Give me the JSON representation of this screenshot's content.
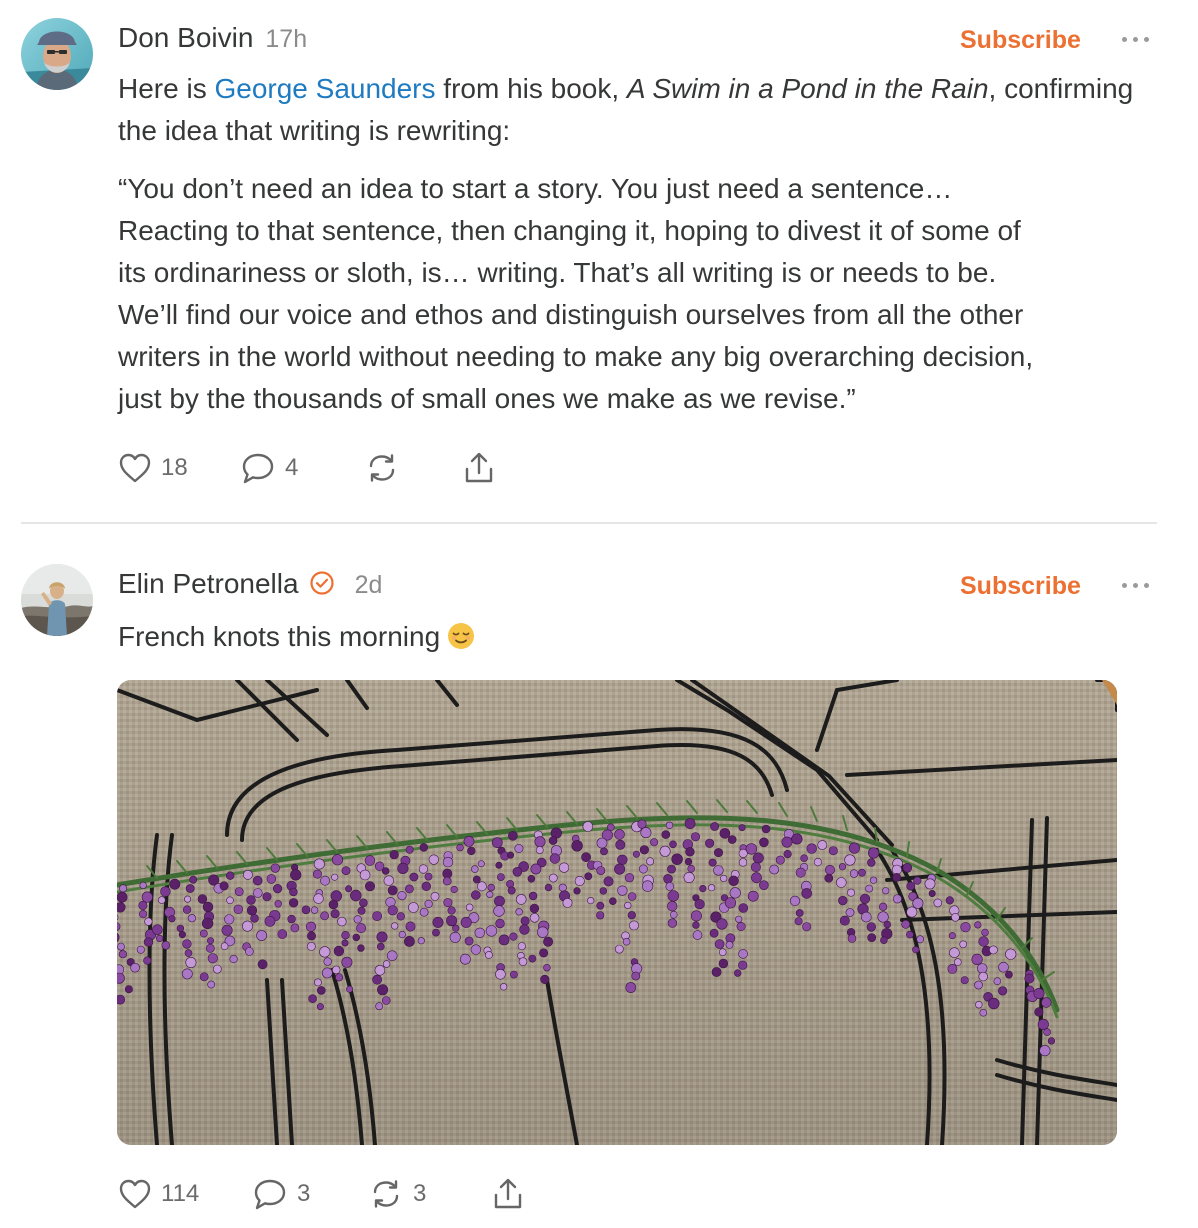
{
  "posts": [
    {
      "author": "Don Boivin",
      "time": "17h",
      "subscribe_label": "Subscribe",
      "intro_before_link": "Here is ",
      "link_text": "George Saunders",
      "intro_after_link": " from his book, ",
      "book_title": "A Swim in a Pond in the Rain",
      "intro_line2": ", confirming the idea that writing is rewriting:",
      "quote_lines": [
        "“You don’t need an idea to start a story. You just need a sentence…",
        "Reacting to that sentence, then changing it, hoping to divest it of some of",
        "its ordinariness or sloth, is… writing. That’s all writing is or needs to be.",
        "We’ll find our voice and ethos and distinguish ourselves from all the other",
        "writers in the world without needing to make any big overarching decision,",
        "just by the thousands of small ones we make as we revise.”"
      ],
      "likes": "18",
      "comments": "4",
      "restacks": "",
      "icons": [
        "heart-icon",
        "comment-icon",
        "restack-icon",
        "share-icon"
      ]
    },
    {
      "author": "Elin Petronella",
      "verified": true,
      "time": "2d",
      "subscribe_label": "Subscribe",
      "text": "French knots this morning",
      "emoji": "relieved-face-emoji",
      "likes": "114",
      "comments": "3",
      "restacks": "3",
      "icons": [
        "heart-icon",
        "comment-icon",
        "restack-icon",
        "share-icon"
      ]
    }
  ],
  "colors": {
    "accent": "#ec7032",
    "link": "#1f7bc1",
    "text": "#363737",
    "muted": "#8b8b8b"
  }
}
